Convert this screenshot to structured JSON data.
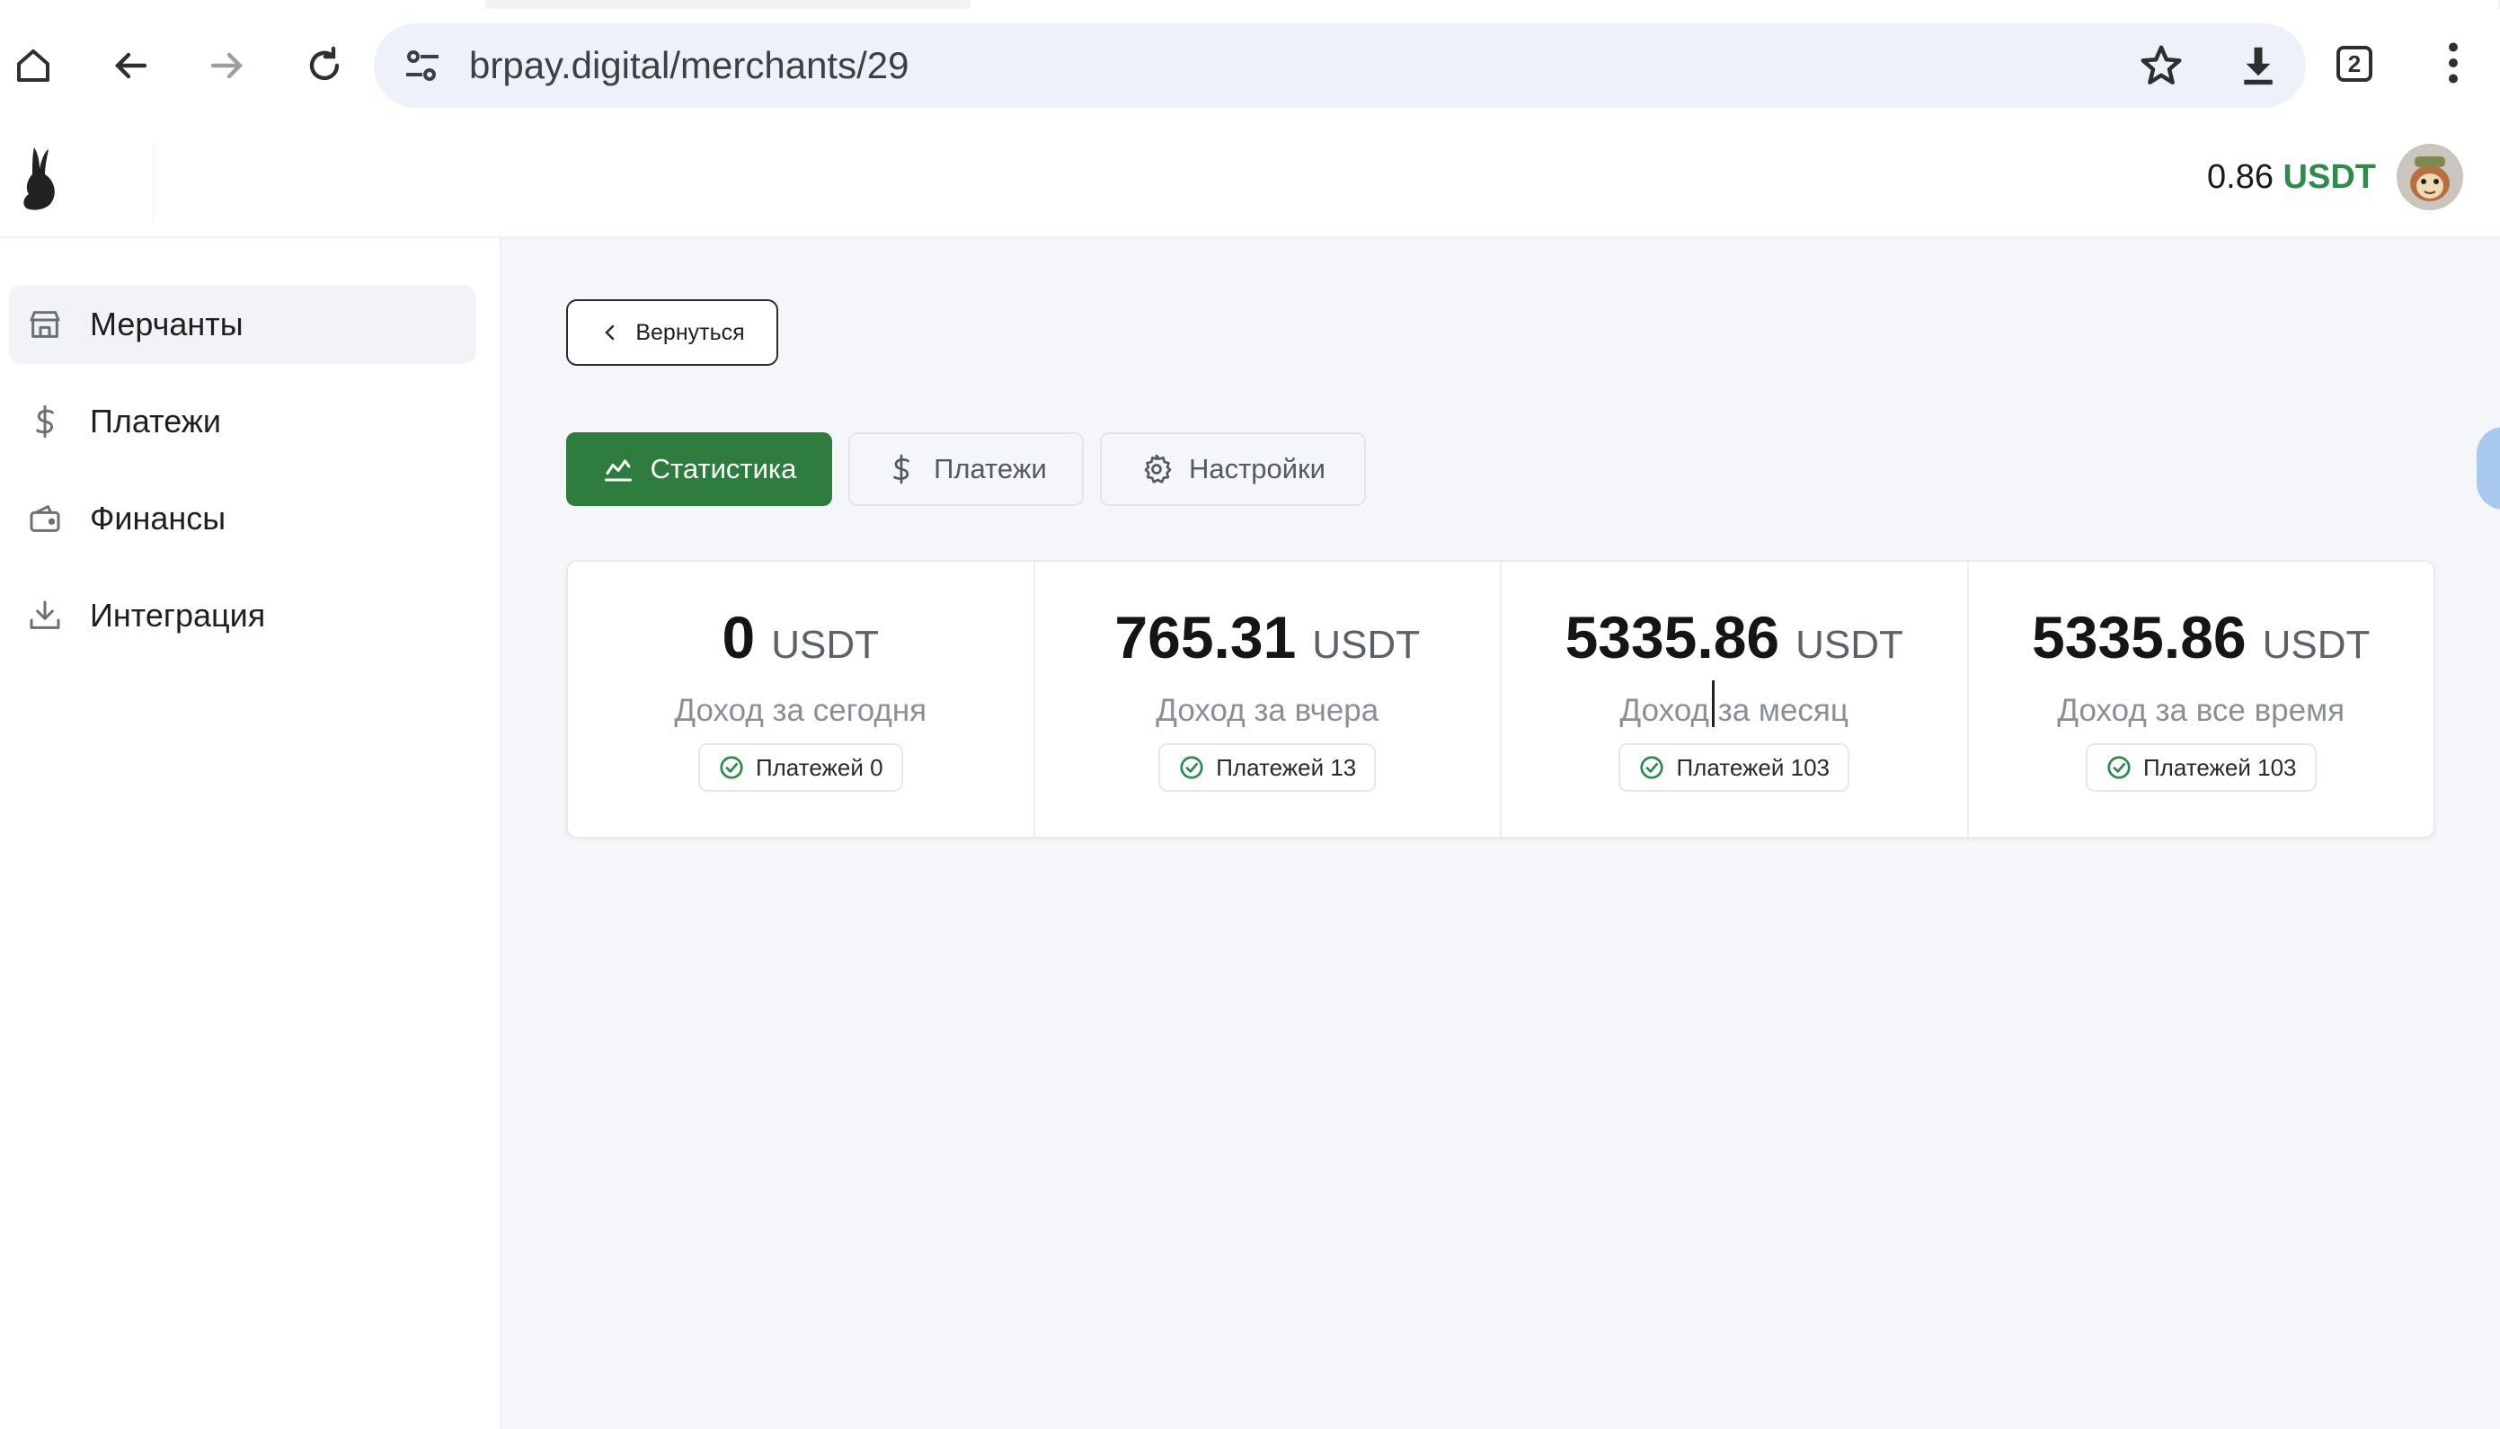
{
  "browser": {
    "url": "brpay.digital/merchants/29",
    "tab_count": "2"
  },
  "header": {
    "balance_value": "0.86",
    "balance_currency": "USDT"
  },
  "sidebar": {
    "items": [
      {
        "label": "Мерчанты",
        "icon": "store-icon",
        "active": true
      },
      {
        "label": "Платежи",
        "icon": "dollar-icon",
        "active": false
      },
      {
        "label": "Финансы",
        "icon": "wallet-icon",
        "active": false
      },
      {
        "label": "Интеграция",
        "icon": "download-tray-icon",
        "active": false
      }
    ]
  },
  "main": {
    "back_label": "Вернуться",
    "tabs": [
      {
        "label": "Статистика",
        "icon": "chart-icon",
        "active": true
      },
      {
        "label": "Платежи",
        "icon": "dollar-icon",
        "active": false
      },
      {
        "label": "Настройки",
        "icon": "gear-icon",
        "active": false
      }
    ],
    "stats": [
      {
        "value": "0",
        "currency": "USDT",
        "caption": "Доход за сегодня",
        "payments": "Платежей 0"
      },
      {
        "value": "765.31",
        "currency": "USDT",
        "caption": "Доход за вчера",
        "payments": "Платежей 13"
      },
      {
        "value": "5335.86",
        "currency": "USDT",
        "caption": "Доход за месяц",
        "payments": "Платежей 103"
      },
      {
        "value": "5335.86",
        "currency": "USDT",
        "caption": "Доход за все время",
        "payments": "Платежей 103"
      }
    ]
  },
  "colors": {
    "accent_green": "#2e7d3e",
    "currency_green": "#2e8b4a",
    "main_background": "#f5f6f9"
  }
}
